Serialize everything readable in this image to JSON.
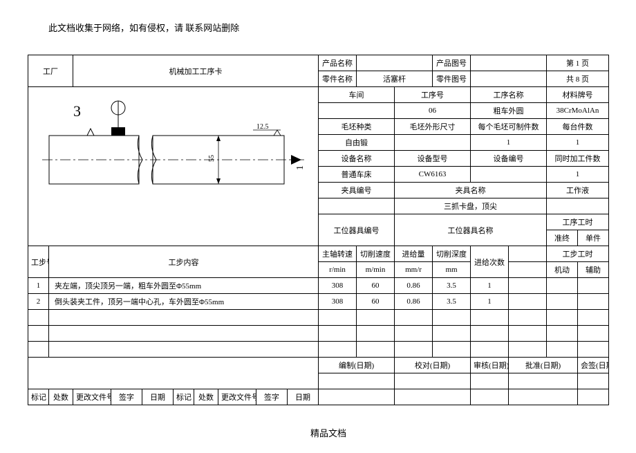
{
  "disclaimer": "此文档收集于网络，如有侵权，请 联系网站删除",
  "footer": "精品文档",
  "header": {
    "factory_label": "工厂",
    "card_title": "机械加工工序卡",
    "product_name_label": "产品名称",
    "product_name": "",
    "product_drawing_label": "产品图号",
    "product_drawing": "",
    "page_current": "第 1 页",
    "part_name_label": "零件名称",
    "part_name": "活塞杆",
    "part_drawing_label": "零件图号",
    "part_drawing": "",
    "page_total": "共 8 页",
    "workshop_label": "车间",
    "workshop": "",
    "process_no_label": "工序号",
    "process_no": "06",
    "process_name_label": "工序名称",
    "process_name": "粗车外圆",
    "material_label": "材料牌号",
    "material": "38CrMoAlAn",
    "blank_type_label": "毛坯种类",
    "blank_type": "自由锻",
    "blank_size_label": "毛坯外形尺寸",
    "blank_size": "",
    "blank_count_label": "每个毛坯可制件数",
    "blank_count": "1",
    "per_machine_label": "每台件数",
    "per_machine": "1",
    "equip_name_label": "设备名称",
    "equip_name": "普通车床",
    "equip_model_label": "设备型号",
    "equip_model": "CW6163",
    "equip_no_label": "设备编号",
    "equip_no": "",
    "simul_label": "同时加工件数",
    "simul": "1",
    "fixture_no_label": "夹具编号",
    "fixture_name_label": "夹具名称",
    "coolant_label": "工作液",
    "fixture_name": "三抓卡盘，顶尖",
    "station_no_label": "工位器具编号",
    "station_name_label": "工位器具名称",
    "proc_time_label": "工序工时",
    "proc_time_prep": "准终",
    "proc_time_unit": "单件"
  },
  "cols": {
    "step_no": "工步号",
    "step_content": "工步内容",
    "spindle": "主轴转速",
    "spindle_unit": "r/min",
    "cut_speed": "切削速度",
    "cut_speed_unit": "m/min",
    "feed": "进给量",
    "feed_unit": "mm/r",
    "depth": "切削深度",
    "depth_unit": "mm",
    "passes": "进给次数",
    "step_time": "工步工时",
    "step_time_machine": "机动",
    "step_time_aux": "辅助"
  },
  "steps": [
    {
      "no": "1",
      "content": "夹左端，顶尖顶另一端，粗车外圆至Φ55mm",
      "spindle": "308",
      "speed": "60",
      "feed": "0.86",
      "depth": "3.5",
      "passes": "1"
    },
    {
      "no": "2",
      "content": "倒头装夹工件，顶另一端中心孔，车外圆至Φ55mm",
      "spindle": "308",
      "speed": "60",
      "feed": "0.86",
      "depth": "3.5",
      "passes": "1"
    }
  ],
  "sig": {
    "compile": "编制(日期)",
    "check": "校对(日期)",
    "review": "审核(日期)",
    "approve": "批准(日期)",
    "countersign": "会签(日期)",
    "mark": "标记",
    "qty": "处数",
    "change_no": "更改文件号",
    "sign": "签字",
    "date": "日期"
  },
  "dwg": {
    "mark_3": "3",
    "dim_55": "55",
    "dim_12_5": "12.5",
    "dim_1": "1"
  }
}
